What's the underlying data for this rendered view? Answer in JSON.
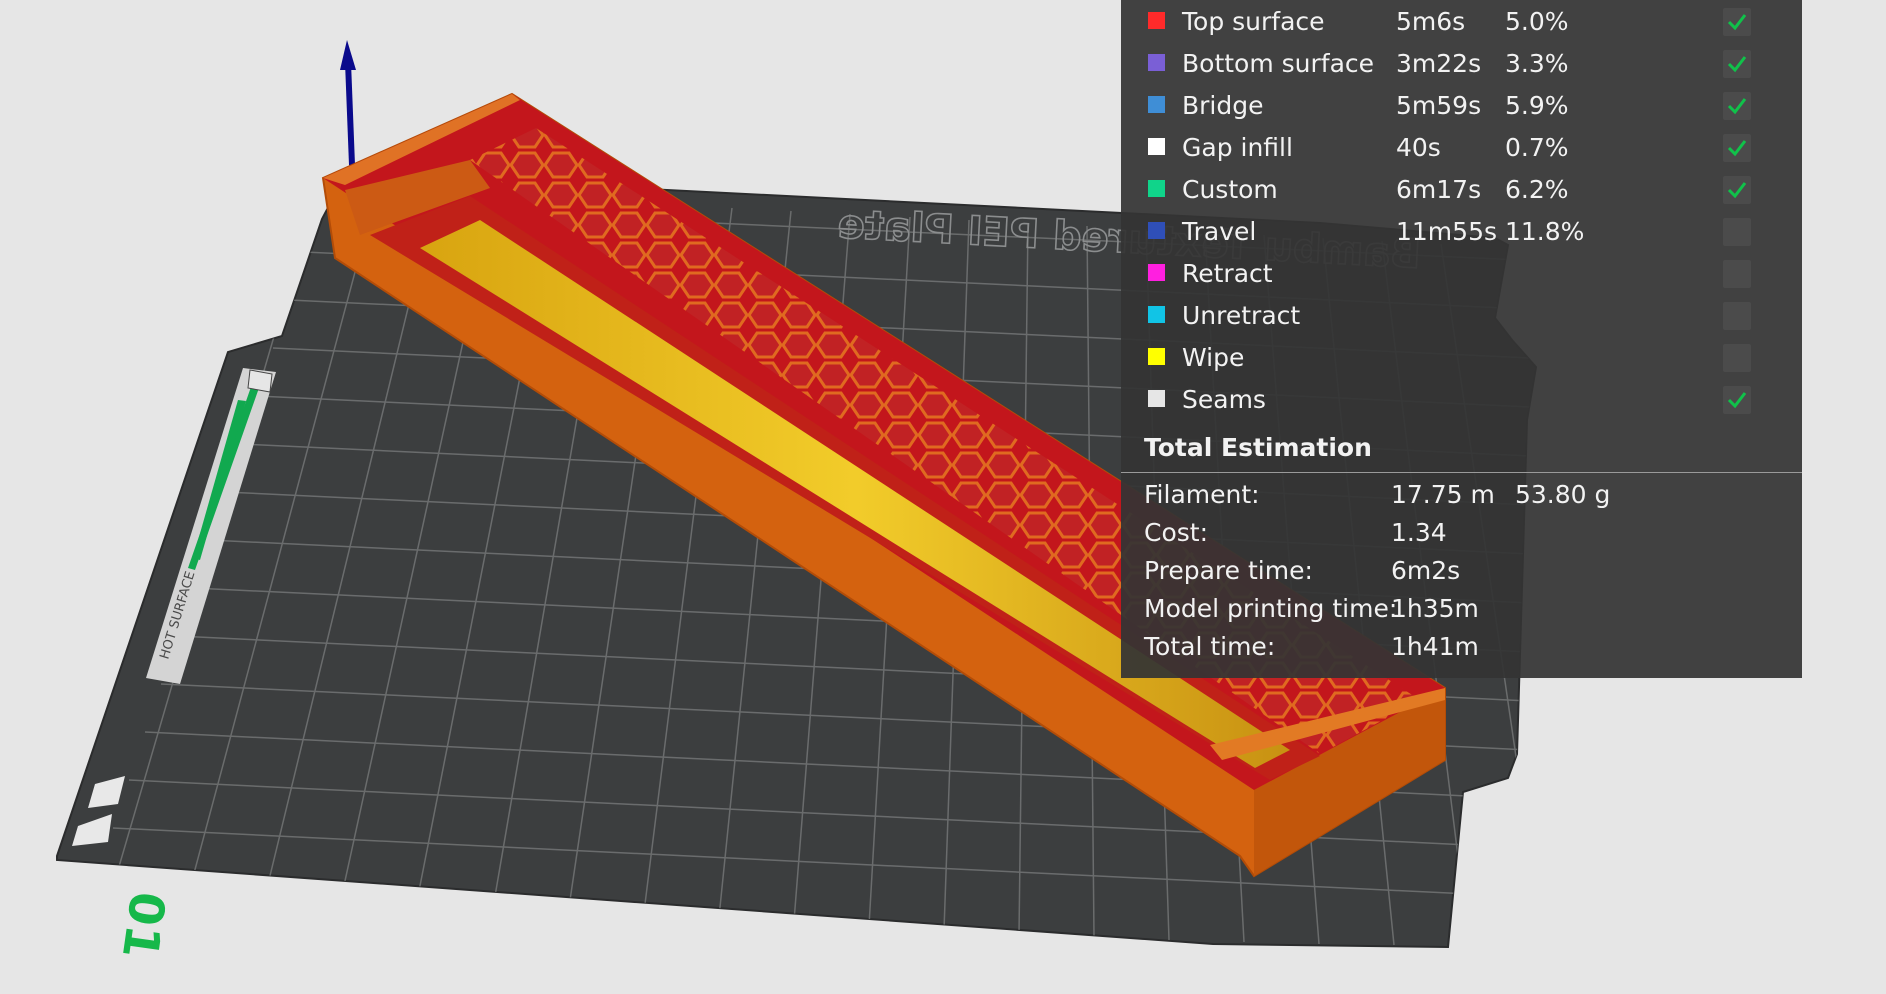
{
  "bed": {
    "plate_label": "Bambu Textured PEI Plate",
    "plate_number": "01",
    "warning_text": "HOT SURFACE"
  },
  "legend": {
    "features": [
      {
        "name": "Top surface",
        "time": "5m6s",
        "percent": "5.0%",
        "color": "#ff2a2a",
        "visible": true
      },
      {
        "name": "Bottom surface",
        "time": "3m22s",
        "percent": "3.3%",
        "color": "#7a5fd6",
        "visible": true
      },
      {
        "name": "Bridge",
        "time": "5m59s",
        "percent": "5.9%",
        "color": "#3f8ed6",
        "visible": true
      },
      {
        "name": "Gap infill",
        "time": "40s",
        "percent": "0.7%",
        "color": "#ffffff",
        "visible": true
      },
      {
        "name": "Custom",
        "time": "6m17s",
        "percent": "6.2%",
        "color": "#10d48a",
        "visible": true
      },
      {
        "name": "Travel",
        "time": "11m55s",
        "percent": "11.8%",
        "color": "#2f4fb8",
        "visible": false
      },
      {
        "name": "Retract",
        "time": "",
        "percent": "",
        "color": "#ff1fe0",
        "visible": false
      },
      {
        "name": "Unretract",
        "time": "",
        "percent": "",
        "color": "#11c4e6",
        "visible": false
      },
      {
        "name": "Wipe",
        "time": "",
        "percent": "",
        "color": "#ffff00",
        "visible": false
      },
      {
        "name": "Seams",
        "time": "",
        "percent": "",
        "color": "#e6e6e6",
        "visible": true
      }
    ]
  },
  "total_estimation": {
    "title": "Total Estimation",
    "filament_label": "Filament:",
    "filament_length": "17.75 m",
    "filament_weight": "53.80 g",
    "cost_label": "Cost:",
    "cost": "1.34",
    "prepare_label": "Prepare time:",
    "prepare_time": "6m2s",
    "model_label": "Model printing time:",
    "model_time": "1h35m",
    "total_label": "Total time:",
    "total_time": "1h41m"
  },
  "colors": {
    "background": "#e6e6e6",
    "plate": "#3c3e3f",
    "model_orange": "#d4620f",
    "model_red": "#b5121a",
    "accent_green": "#10c24a",
    "axis_blue": "#0a0a8c"
  }
}
